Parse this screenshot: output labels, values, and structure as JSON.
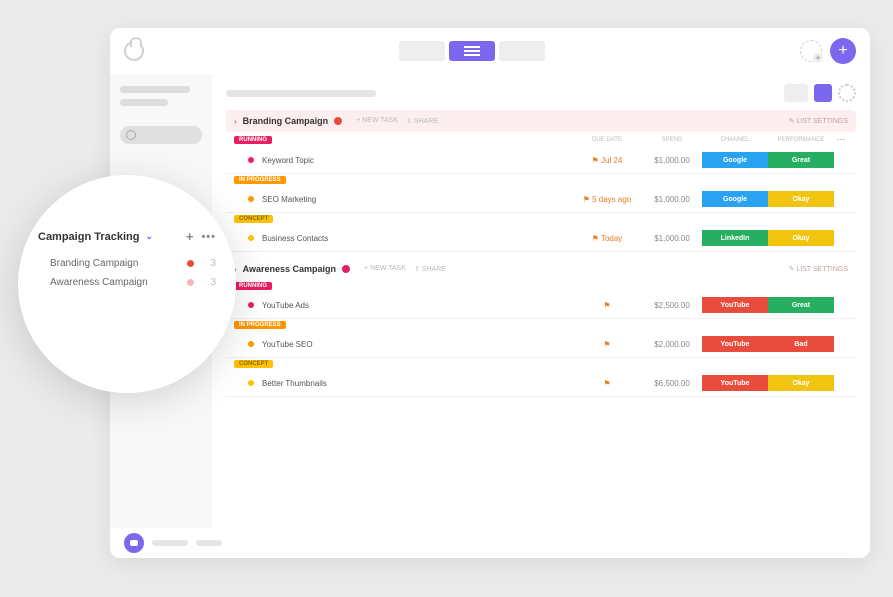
{
  "popout": {
    "title": "Campaign Tracking",
    "items": [
      {
        "label": "Branding Campaign",
        "count": "3",
        "color": "red"
      },
      {
        "label": "Awareness Campaign",
        "count": "3",
        "color": "pk"
      }
    ]
  },
  "groups": [
    {
      "title": "Branding Campaign",
      "dot": "red",
      "actions": {
        "new": "+ NEW TASK",
        "share": "⇪ SHARE"
      },
      "settings": "✎ LIST SETTINGS",
      "headbg": "pink",
      "cols": {
        "date": "DUE DATE",
        "spend": "SPEND",
        "ch": "CHANNEL",
        "perf": "PERFORMANCE"
      },
      "sections": [
        {
          "tag": "RUNNING",
          "tagcls": "running",
          "rows": [
            {
              "bullet": "pink",
              "name": "Keyword Topic",
              "date": "⚑ Jul 24",
              "spend": "$1,000.00",
              "ch": "Google",
              "chcls": "google",
              "perf": "Great",
              "perfcls": "great"
            }
          ]
        },
        {
          "tag": "IN PROGRESS",
          "tagcls": "progress",
          "rows": [
            {
              "bullet": "orange",
              "name": "SEO Marketing",
              "date": "⚑ 5 days ago",
              "spend": "$1,000.00",
              "ch": "Google",
              "chcls": "google",
              "perf": "Okay",
              "perfcls": "okay"
            }
          ]
        },
        {
          "tag": "CONCEPT",
          "tagcls": "concept",
          "rows": [
            {
              "bullet": "yellow",
              "name": "Business Contacts",
              "date": "⚑ Today",
              "spend": "$1,000.00",
              "ch": "LinkedIn",
              "chcls": "linkedin",
              "perf": "Okay",
              "perfcls": "okay"
            }
          ]
        }
      ]
    },
    {
      "title": "Awareness Campaign",
      "dot": "pink",
      "actions": {
        "new": "+ NEW TASK",
        "share": "⇪ SHARE"
      },
      "settings": "✎ LIST SETTINGS",
      "headbg": "",
      "cols": null,
      "sections": [
        {
          "tag": "RUNNING",
          "tagcls": "running",
          "rows": [
            {
              "bullet": "pink",
              "name": "YouTube Ads",
              "date": "⚑",
              "spend": "$2,500.00",
              "ch": "YouTube",
              "chcls": "youtube",
              "perf": "Great",
              "perfcls": "great"
            }
          ]
        },
        {
          "tag": "IN PROGRESS",
          "tagcls": "progress",
          "rows": [
            {
              "bullet": "orange",
              "name": "YouTube SEO",
              "date": "⚑",
              "spend": "$2,000.00",
              "ch": "YouTube",
              "chcls": "youtube",
              "perf": "Bad",
              "perfcls": "bad"
            }
          ]
        },
        {
          "tag": "CONCEPT",
          "tagcls": "concept",
          "rows": [
            {
              "bullet": "yellow",
              "name": "Better Thumbnails",
              "date": "⚑",
              "spend": "$6,500.00",
              "ch": "YouTube",
              "chcls": "youtube",
              "perf": "Okay",
              "perfcls": "okay"
            }
          ]
        }
      ]
    }
  ]
}
